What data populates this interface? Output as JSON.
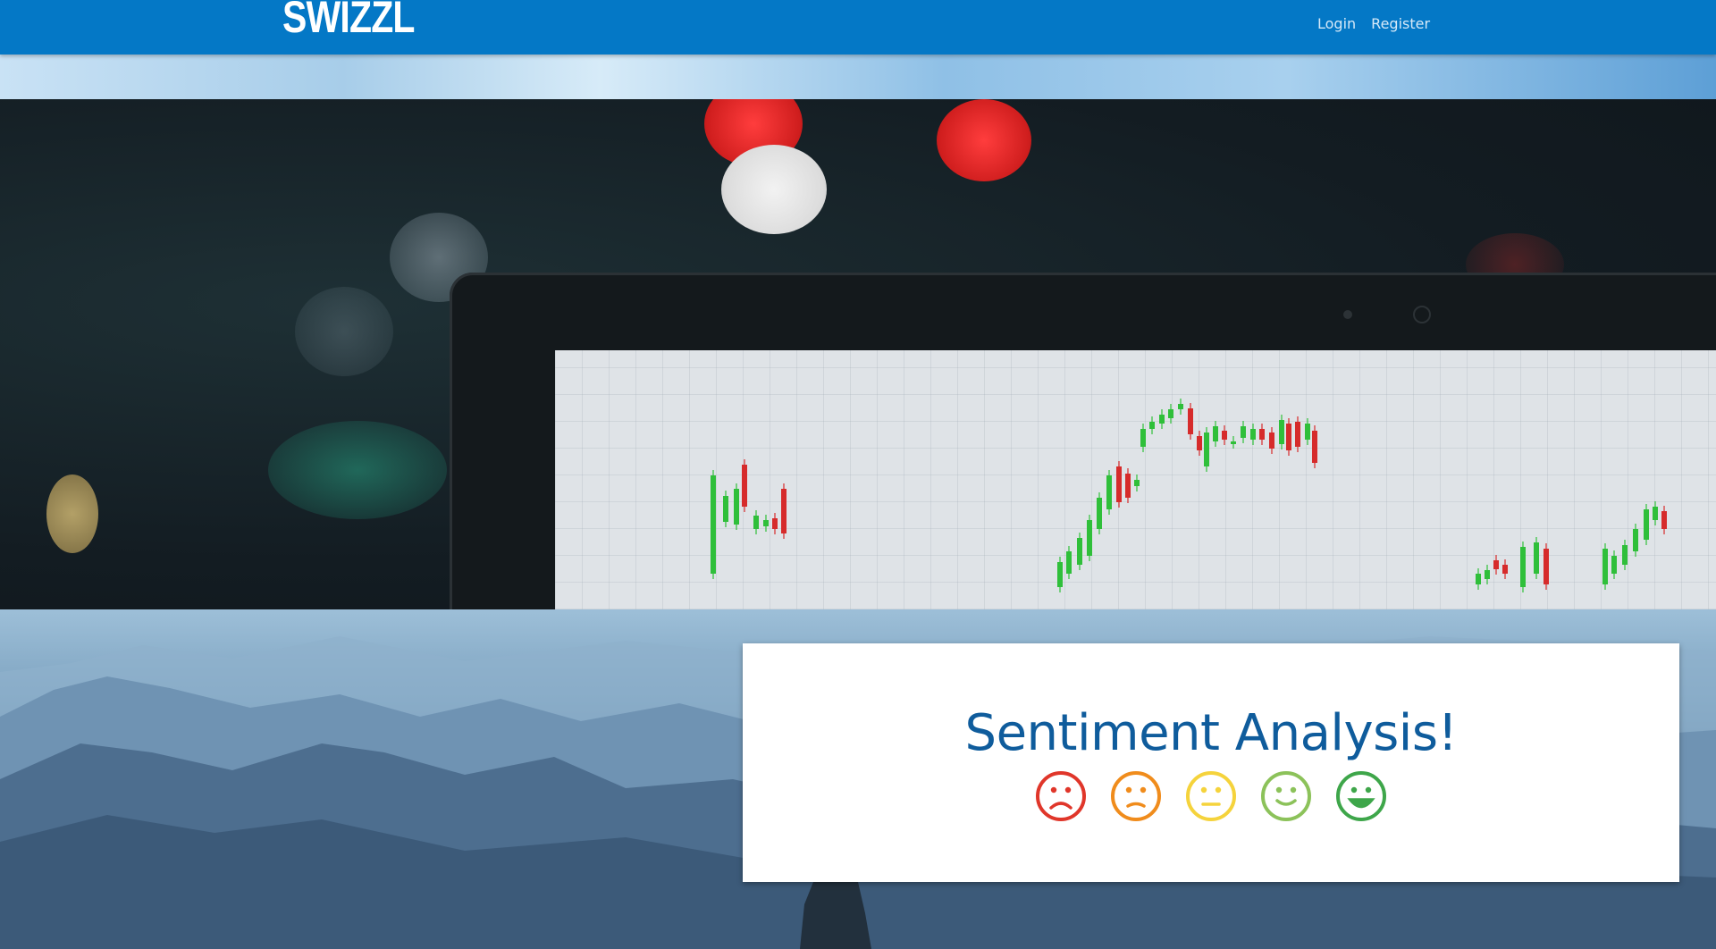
{
  "navbar": {
    "logo": "SWIZZL",
    "links": [
      "Login",
      "Register"
    ],
    "color": "#0478c6"
  },
  "hero": {
    "image": "laptop-with-candlestick-chart-icon"
  },
  "card": {
    "title": "Sentiment Analysis!",
    "faces": [
      {
        "name": "very-sad-face-icon",
        "color": "#e0362a"
      },
      {
        "name": "sad-face-icon",
        "color": "#f08c1c"
      },
      {
        "name": "neutral-face-icon",
        "color": "#f5d33c"
      },
      {
        "name": "smile-face-icon",
        "color": "#8cc25a"
      },
      {
        "name": "grin-face-icon",
        "color": "#3ea64a"
      }
    ]
  },
  "background": {
    "image": "mountain-landscape-icon"
  }
}
